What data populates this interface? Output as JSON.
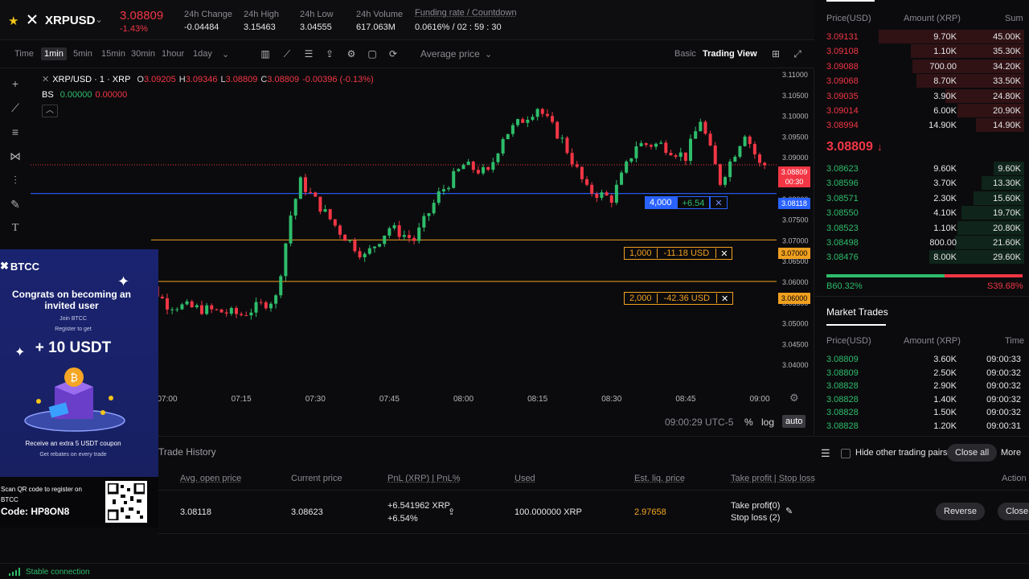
{
  "ticker": {
    "symbol": "XRPUSD",
    "price": "3.08809",
    "change_pct": "-1.43%",
    "stats": [
      {
        "label": "24h Change",
        "value": "-0.04484"
      },
      {
        "label": "24h High",
        "value": "3.15463"
      },
      {
        "label": "24h Low",
        "value": "3.04555"
      },
      {
        "label": "24h Volume",
        "value": "617.063M"
      }
    ],
    "funding_label": "Funding rate / Countdown",
    "funding_value": "0.0616% / 02 : 59 : 30"
  },
  "toolbar": {
    "timeframes": [
      "Time",
      "1min",
      "5min",
      "15min",
      "30min",
      "1hour",
      "1day"
    ],
    "active_timeframe": "1min",
    "price_type": "Average price",
    "view_basic": "Basic",
    "view_tv": "Trading View"
  },
  "chart": {
    "legend_symbol": "XRP/USD · 1 · XRP",
    "ohlc": {
      "o": "3.09205",
      "h": "3.09346",
      "l": "3.08809",
      "c": "3.08809",
      "chg": "-0.00396 (-0.13%)"
    },
    "indicator": {
      "name": "BS",
      "v1": "0.00000",
      "v2": "0.00000"
    },
    "y_ticks": [
      "3.11000",
      "3.10500",
      "3.10000",
      "3.09500",
      "3.09000",
      "3.08500",
      "3.08000",
      "3.07500",
      "3.07000",
      "3.06500",
      "3.06000",
      "3.05500",
      "3.05000",
      "3.04500",
      "3.04000"
    ],
    "x_ticks": [
      "07:00",
      "07:15",
      "07:30",
      "07:45",
      "08:00",
      "08:15",
      "08:30",
      "08:45",
      "09:00"
    ],
    "current_price_tag": "3.08809",
    "current_countdown": "00:30",
    "position_line": {
      "qty": "4,000",
      "pnl": "+6.54",
      "price": "3.08118"
    },
    "order_lines": [
      {
        "qty": "1,000",
        "pnl": "-11.18 USD",
        "price": "3.07000"
      },
      {
        "qty": "2,000",
        "pnl": "-42.36 USD",
        "price": "3.06000"
      }
    ],
    "clock": "09:00:29 UTC-5",
    "pct_btn": "%",
    "log_btn": "log",
    "auto_btn": "auto"
  },
  "chart_data": {
    "type": "candlestick",
    "title": "XRP/USD · 1 · XRP",
    "xlabel": "",
    "ylabel": "",
    "ylim": [
      3.04,
      3.111
    ],
    "x_range": [
      "06:53",
      "09:01"
    ],
    "approx_close_path": [
      {
        "x": "06:53",
        "y": 3.0635
      },
      {
        "x": "07:00",
        "y": 3.0545
      },
      {
        "x": "07:15",
        "y": 3.052
      },
      {
        "x": "07:22",
        "y": 3.056
      },
      {
        "x": "07:25",
        "y": 3.076
      },
      {
        "x": "07:27",
        "y": 3.084
      },
      {
        "x": "07:35",
        "y": 3.072
      },
      {
        "x": "07:40",
        "y": 3.066
      },
      {
        "x": "07:45",
        "y": 3.073
      },
      {
        "x": "07:50",
        "y": 3.07
      },
      {
        "x": "07:55",
        "y": 3.081
      },
      {
        "x": "08:00",
        "y": 3.088
      },
      {
        "x": "08:05",
        "y": 3.086
      },
      {
        "x": "08:08",
        "y": 3.095
      },
      {
        "x": "08:15",
        "y": 3.102
      },
      {
        "x": "08:20",
        "y": 3.094
      },
      {
        "x": "08:25",
        "y": 3.082
      },
      {
        "x": "08:30",
        "y": 3.08
      },
      {
        "x": "08:35",
        "y": 3.093
      },
      {
        "x": "08:40",
        "y": 3.093
      },
      {
        "x": "08:45",
        "y": 3.09
      },
      {
        "x": "08:48",
        "y": 3.099
      },
      {
        "x": "08:52",
        "y": 3.084
      },
      {
        "x": "08:57",
        "y": 3.096
      },
      {
        "x": "09:00",
        "y": 3.0881
      }
    ]
  },
  "promo": {
    "brand": "BTCC",
    "headline": "Congrats on becoming an invited user",
    "join": "Join BTCC",
    "register": "Register to get",
    "reward": "+ 10 USDT",
    "extra": "Receive an extra 5 USDT coupon",
    "rebates": "Get rebates on every trade",
    "scan": "Scan QR code to register on BTCC",
    "code": "Code: HP8ON8"
  },
  "positions": {
    "tab": "Trade History",
    "hide_label": "Hide other trading pairs",
    "close_all": "Close all",
    "more": "More",
    "headers": [
      "Avg. open price",
      "Current price",
      "PnL (XRP) | PnL%",
      "Used",
      "Est. liq. price",
      "Take profit | Stop loss",
      "Action"
    ],
    "row": {
      "avg_open": "3.08118",
      "current": "3.08623",
      "pnl": "+6.541962 XRP",
      "pnl_pct": "+6.54%",
      "used": "100.000000 XRP",
      "liq": "2.97658",
      "tp_label": "Take profit",
      "tp_count": "(0)",
      "sl_label": "Stop loss",
      "sl_count": "(2)",
      "reverse": "Reverse",
      "close": "Close"
    }
  },
  "status": {
    "text": "Stable connection"
  },
  "orderbook": {
    "headers": [
      "Price(USD)",
      "Amount (XRP)",
      "Sum"
    ],
    "asks": [
      {
        "price": "3.09131",
        "amount": "9.70K",
        "sum": "45.00K",
        "depth": 0.72
      },
      {
        "price": "3.09108",
        "amount": "1.10K",
        "sum": "35.30K",
        "depth": 0.56
      },
      {
        "price": "3.09088",
        "amount": "700.00",
        "sum": "34.20K",
        "depth": 0.55
      },
      {
        "price": "3.09068",
        "amount": "8.70K",
        "sum": "33.50K",
        "depth": 0.53
      },
      {
        "price": "3.09035",
        "amount": "3.90K",
        "sum": "24.80K",
        "depth": 0.39
      },
      {
        "price": "3.09014",
        "amount": "6.00K",
        "sum": "20.90K",
        "depth": 0.33
      },
      {
        "price": "3.08994",
        "amount": "14.90K",
        "sum": "14.90K",
        "depth": 0.24
      }
    ],
    "mid_price": "3.08809",
    "bids": [
      {
        "price": "3.08623",
        "amount": "9.60K",
        "sum": "9.60K",
        "depth": 0.15
      },
      {
        "price": "3.08596",
        "amount": "3.70K",
        "sum": "13.30K",
        "depth": 0.21
      },
      {
        "price": "3.08571",
        "amount": "2.30K",
        "sum": "15.60K",
        "depth": 0.25
      },
      {
        "price": "3.08550",
        "amount": "4.10K",
        "sum": "19.70K",
        "depth": 0.31
      },
      {
        "price": "3.08523",
        "amount": "1.10K",
        "sum": "20.80K",
        "depth": 0.33
      },
      {
        "price": "3.08498",
        "amount": "800.00",
        "sum": "21.60K",
        "depth": 0.34
      },
      {
        "price": "3.08476",
        "amount": "8.00K",
        "sum": "29.60K",
        "depth": 0.47
      }
    ],
    "buy_ratio": "B60.32%",
    "sell_ratio": "S39.68%",
    "buy_fraction": 0.6032
  },
  "market_trades": {
    "title": "Market Trades",
    "headers": [
      "Price(USD)",
      "Amount (XRP)",
      "Time"
    ],
    "rows": [
      {
        "price": "3.08809",
        "amount": "3.60K",
        "time": "09:00:33"
      },
      {
        "price": "3.08809",
        "amount": "2.50K",
        "time": "09:00:32"
      },
      {
        "price": "3.08828",
        "amount": "2.90K",
        "time": "09:00:32"
      },
      {
        "price": "3.08828",
        "amount": "1.40K",
        "time": "09:00:32"
      },
      {
        "price": "3.08828",
        "amount": "1.50K",
        "time": "09:00:32"
      },
      {
        "price": "3.08828",
        "amount": "1.20K",
        "time": "09:00:31"
      }
    ]
  },
  "colors": {
    "up": "#2ebd6b",
    "down": "#f23645",
    "accent_orange": "#f0a020",
    "position_blue": "#2962ff"
  }
}
